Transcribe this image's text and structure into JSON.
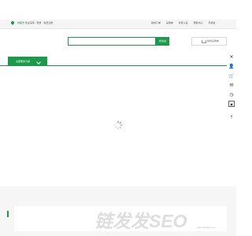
{
  "topbar": {
    "city": "成都市",
    "location_text": "欢迎来到 · 登录 · 免费注册",
    "links": [
      "我的订单",
      "采购单",
      "商家入驻",
      "帮助中心",
      "手机版"
    ]
  },
  "search": {
    "placeholder": "",
    "button_label": "搜全站"
  },
  "cart": {
    "label": "我的采购单"
  },
  "category": {
    "label": "全部服务分类"
  },
  "sidebar": {
    "items": [
      {
        "icon": "close-icon",
        "glyph": "✕"
      },
      {
        "icon": "user-icon",
        "glyph": "👤"
      },
      {
        "icon": "cart-icon",
        "glyph": "🛒"
      },
      {
        "icon": "message-icon",
        "glyph": "✉"
      },
      {
        "icon": "history-icon",
        "glyph": "◷"
      },
      {
        "icon": "qrcode-icon",
        "glyph": "▣"
      },
      {
        "icon": "back-to-top-icon",
        "glyph": "⇡"
      }
    ]
  },
  "watermark": {
    "text": "链发发SEO",
    "sub": "www.lianfafa.com"
  },
  "colors": {
    "accent": "#1a9a4a",
    "gray_bg": "#f6f6f6"
  }
}
